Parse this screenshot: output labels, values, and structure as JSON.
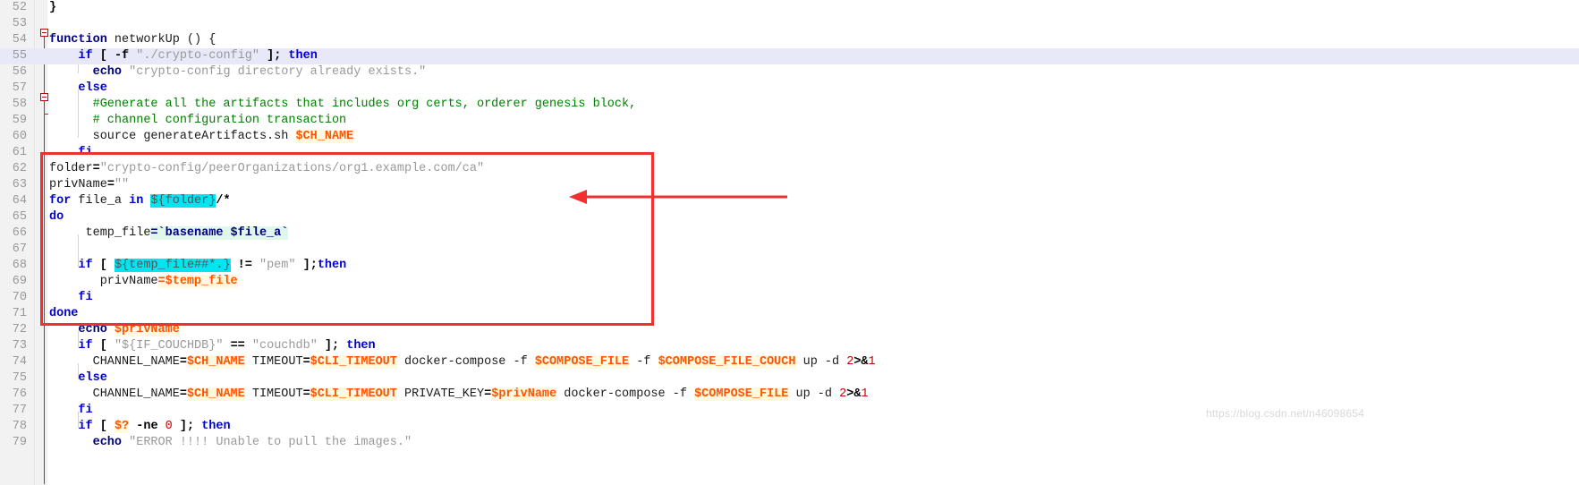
{
  "editor": {
    "language": "shell",
    "highlighted_line": 55,
    "first_line": 52,
    "last_line": 79,
    "colors": {
      "background": "#ffffff",
      "gutter": "#f2f2f2",
      "line_number": "#999999",
      "keyword": "#0000cc",
      "string": "#999999",
      "comment": "#008000",
      "variable": "#ff5500",
      "variable_highlight_bg": "#fff9e0",
      "number": "#cc0000",
      "current_line_bg": "#e8e8f8",
      "selection_cyan": "#00e5f0",
      "selection_mint": "#e0f7ec",
      "annotation_red": "#f23030",
      "fold_marker": "#cc0000"
    }
  },
  "lines": [
    {
      "n": "52",
      "indent": 0,
      "html": "<span class=\"op\">}</span>"
    },
    {
      "n": "53",
      "indent": 0,
      "html": ""
    },
    {
      "n": "54",
      "indent": 0,
      "html": "<span class=\"bi\">function</span> <span class=\"plain\">networkUp () {</span>"
    },
    {
      "n": "55",
      "indent": 0,
      "html": "<span class=\"plain\">    </span><span class=\"kw\">if</span> <span class=\"op\">[</span> <span class=\"op\">-f</span> <span class=\"str\">\"./crypto-config\"</span> <span class=\"op\">];</span> <span class=\"kw\">then</span>"
    },
    {
      "n": "56",
      "indent": 0,
      "html": "<span class=\"plain\">      </span><span class=\"bi\">echo</span> <span class=\"str\">\"crypto-config directory already exists.\"</span>"
    },
    {
      "n": "57",
      "indent": 0,
      "html": "<span class=\"plain\">    </span><span class=\"kw\">else</span>"
    },
    {
      "n": "58",
      "indent": 0,
      "html": "<span class=\"plain\">      </span><span class=\"cmt\">#Generate all the artifacts that includes org certs, orderer genesis block,</span>"
    },
    {
      "n": "59",
      "indent": 0,
      "html": "<span class=\"plain\">      </span><span class=\"cmt\"># channel configuration transaction</span>"
    },
    {
      "n": "60",
      "indent": 0,
      "html": "<span class=\"plain\">      source generateArtifacts.sh </span><span class=\"var\">$CH_NAME</span>"
    },
    {
      "n": "61",
      "indent": 0,
      "html": "<span class=\"plain\">    </span><span class=\"kw\">fi</span>"
    },
    {
      "n": "62",
      "indent": 0,
      "html": "<span class=\"plain\">folder</span><span class=\"op\">=</span><span class=\"str\">\"crypto-config/peerOrganizations/org1.example.com/ca\"</span>"
    },
    {
      "n": "63",
      "indent": 0,
      "html": "<span class=\"plain\">privName</span><span class=\"op\">=</span><span class=\"str\">\"\"</span>"
    },
    {
      "n": "64",
      "indent": 0,
      "html": "<span class=\"kw\">for</span> <span class=\"plain\">file_a</span> <span class=\"kw\">in</span> <span class=\"cyan\">${folder}</span><span class=\"op\">/*</span>"
    },
    {
      "n": "65",
      "indent": 0,
      "html": "<span class=\"kw\">do</span>"
    },
    {
      "n": "66",
      "indent": 0,
      "html": "<span class=\"plain\">     temp_file</span><span class=\"mintb\">=`</span><span class=\"mintb\">basename $file_a</span><span class=\"mintb\">`</span>"
    },
    {
      "n": "67",
      "indent": 0,
      "html": ""
    },
    {
      "n": "68",
      "indent": 0,
      "html": "<span class=\"plain\">    </span><span class=\"kw\">if</span> <span class=\"op\">[</span> <span class=\"cyan\">${temp_file##*.}</span> <span class=\"op\">!=</span> <span class=\"str\">\"pem\"</span> <span class=\"op\">];</span><span class=\"kw\">then</span>"
    },
    {
      "n": "69",
      "indent": 0,
      "html": "<span class=\"plain\">       privName</span><span class=\"var\">=$temp_file</span>"
    },
    {
      "n": "70",
      "indent": 0,
      "html": "<span class=\"plain\">    </span><span class=\"kw\">fi</span>"
    },
    {
      "n": "71",
      "indent": 0,
      "html": "<span class=\"kw\">done</span>"
    },
    {
      "n": "72",
      "indent": 0,
      "html": "<span class=\"plain\">    </span><span class=\"bi\">echo</span> <span class=\"var\">$privName</span>"
    },
    {
      "n": "73",
      "indent": 0,
      "html": "<span class=\"plain\">    </span><span class=\"kw\">if</span> <span class=\"op\">[</span> <span class=\"str\">\"${IF_COUCHDB}\"</span> <span class=\"op\">==</span> <span class=\"str\">\"couchdb\"</span> <span class=\"op\">];</span> <span class=\"kw\">then</span>"
    },
    {
      "n": "74",
      "indent": 0,
      "html": "<span class=\"plain\">      CHANNEL_NAME</span><span class=\"op\">=</span><span class=\"var\">$CH_NAME</span><span class=\"plain\"> TIMEOUT</span><span class=\"op\">=</span><span class=\"var\">$CLI_TIMEOUT</span><span class=\"plain\"> docker-compose -f </span><span class=\"var\">$COMPOSE_FILE</span><span class=\"plain\"> -f </span><span class=\"var\">$COMPOSE_FILE_COUCH</span><span class=\"plain\"> up -d </span><span class=\"num\">2</span><span class=\"op\">>&</span><span class=\"num\">1</span>"
    },
    {
      "n": "75",
      "indent": 0,
      "html": "<span class=\"plain\">    </span><span class=\"kw\">else</span>"
    },
    {
      "n": "76",
      "indent": 0,
      "html": "<span class=\"plain\">      CHANNEL_NAME</span><span class=\"op\">=</span><span class=\"var\">$CH_NAME</span><span class=\"plain\"> TIMEOUT</span><span class=\"op\">=</span><span class=\"var\">$CLI_TIMEOUT</span><span class=\"plain\"> PRIVATE_KEY</span><span class=\"op\">=</span><span class=\"var\">$privName</span><span class=\"plain\"> docker-compose -f </span><span class=\"var\">$COMPOSE_FILE</span><span class=\"plain\"> up -d </span><span class=\"num\">2</span><span class=\"op\">>&</span><span class=\"num\">1</span>"
    },
    {
      "n": "77",
      "indent": 0,
      "html": "<span class=\"plain\">    </span><span class=\"kw\">fi</span>"
    },
    {
      "n": "78",
      "indent": 0,
      "html": "<span class=\"plain\">    </span><span class=\"kw\">if</span> <span class=\"op\">[</span> <span class=\"var\">$?</span> <span class=\"op\">-ne</span> <span class=\"num\">0</span> <span class=\"op\">];</span> <span class=\"kw\">then</span>"
    },
    {
      "n": "79",
      "indent": 0,
      "html": "<span class=\"plain\">      </span><span class=\"bi\">echo</span> <span class=\"str\">\"ERROR !!!! Unable to pull the images.\"</span>"
    }
  ],
  "code_text": {
    "l52": "}",
    "l53": "",
    "l54": "function networkUp () {",
    "l55": "    if [ -f \"./crypto-config\" ]; then",
    "l56": "      echo \"crypto-config directory already exists.\"",
    "l57": "    else",
    "l58": "      #Generate all the artifacts that includes org certs, orderer genesis block,",
    "l59": "      # channel configuration transaction",
    "l60": "      source generateArtifacts.sh $CH_NAME",
    "l61": "    fi",
    "l62": "folder=\"crypto-config/peerOrganizations/org1.example.com/ca\"",
    "l63": "privName=\"\"",
    "l64": "for file_a in ${folder}/*",
    "l65": "do",
    "l66": "     temp_file=`basename $file_a`",
    "l67": "",
    "l68": "    if [ ${temp_file##*.} != \"pem\" ];then",
    "l69": "       privName=$temp_file",
    "l70": "    fi",
    "l71": "done",
    "l72": "    echo $privName",
    "l73": "    if [ \"${IF_COUCHDB}\" == \"couchdb\" ]; then",
    "l74": "      CHANNEL_NAME=$CH_NAME TIMEOUT=$CLI_TIMEOUT docker-compose -f $COMPOSE_FILE -f $COMPOSE_FILE_COUCH up -d 2>&1",
    "l75": "    else",
    "l76": "      CHANNEL_NAME=$CH_NAME TIMEOUT=$CLI_TIMEOUT PRIVATE_KEY=$privName docker-compose -f $COMPOSE_FILE up -d 2>&1",
    "l77": "    fi",
    "l78": "    if [ $? -ne 0 ]; then",
    "l79": "      echo \"ERROR !!!! Unable to pull the images.\""
  },
  "annotations": {
    "highlight_box": {
      "label": "red-rectangle-annotation",
      "covers_lines": "62-72",
      "color": "#f23030"
    },
    "arrow": {
      "label": "red-arrow-annotation",
      "points_to_line": "64",
      "direction": "left",
      "color": "#f23030"
    }
  },
  "watermark": {
    "text": "https://blog.csdn.net/n46098654"
  }
}
